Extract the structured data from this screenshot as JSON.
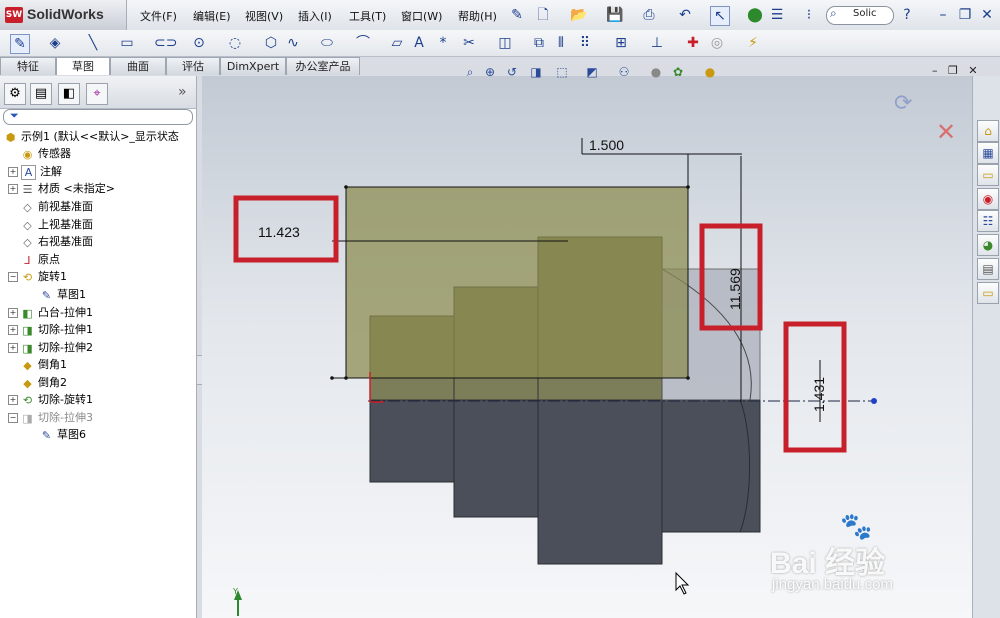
{
  "app": {
    "logo_badge": "SW",
    "name": "SolidWorks"
  },
  "menu": [
    {
      "label": "文件(F)"
    },
    {
      "label": "编辑(E)"
    },
    {
      "label": "视图(V)"
    },
    {
      "label": "插入(I)"
    },
    {
      "label": "工具(T)"
    },
    {
      "label": "窗口(W)"
    },
    {
      "label": "帮助(H)"
    }
  ],
  "search": {
    "value": "Solic"
  },
  "help_glyph": "?",
  "tabs": [
    {
      "label": "特征"
    },
    {
      "label": "草图",
      "active": true
    },
    {
      "label": "曲面"
    },
    {
      "label": "评估"
    },
    {
      "label": "DimXpert"
    },
    {
      "label": "办公室产品"
    }
  ],
  "panel": {
    "collapse_glyph": "»"
  },
  "tree": [
    {
      "label": "示例1  (默认<<默认>_显示状态",
      "icon": "part-icon"
    },
    {
      "label": "传感器",
      "icon": "sensor-icon"
    },
    {
      "label": "注解",
      "icon": "annotation-icon",
      "expandable": true
    },
    {
      "label": "材质 <未指定>",
      "icon": "material-icon",
      "expandable": true
    },
    {
      "label": "前视基准面",
      "icon": "plane-icon"
    },
    {
      "label": "上视基准面",
      "icon": "plane-icon"
    },
    {
      "label": "右视基准面",
      "icon": "plane-icon"
    },
    {
      "label": "原点",
      "icon": "origin-icon"
    },
    {
      "label": "旋转1",
      "icon": "revolve-icon",
      "expandable": true,
      "expanded": true
    },
    {
      "label": "草图1",
      "icon": "sketch-icon",
      "child": true
    },
    {
      "label": "凸台-拉伸1",
      "icon": "boss-extrude-icon",
      "expandable": true
    },
    {
      "label": "切除-拉伸1",
      "icon": "cut-extrude-icon",
      "expandable": true
    },
    {
      "label": "切除-拉伸2",
      "icon": "cut-extrude-icon",
      "expandable": true
    },
    {
      "label": "倒角1",
      "icon": "chamfer-icon"
    },
    {
      "label": "倒角2",
      "icon": "chamfer-icon"
    },
    {
      "label": "切除-旋转1",
      "icon": "cut-revolve-icon",
      "expandable": true
    },
    {
      "label": "切除-拉伸3",
      "icon": "cut-extrude-icon",
      "expandable": true,
      "expanded": true,
      "suppressed": true
    },
    {
      "label": "草图6",
      "icon": "sketch-icon",
      "child": true
    }
  ],
  "dimensions": [
    {
      "value": "1.500"
    },
    {
      "value": "11.423"
    },
    {
      "value": "11.569"
    },
    {
      "value": "1.431"
    }
  ],
  "axis_label": "Y",
  "colors": {
    "highlight_box": "#c8202a",
    "sketch_fill": "#8a8a4e",
    "part_body": "#4b4f5a"
  },
  "watermark": {
    "brand": "Bai  经验",
    "url": "jingyan.baidu.com"
  }
}
